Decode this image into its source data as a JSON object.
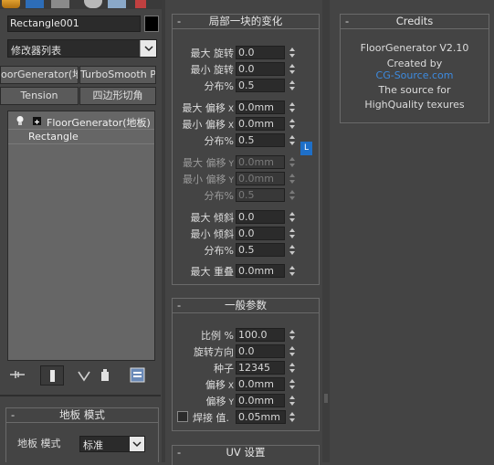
{
  "object": {
    "name": "Rectangle001",
    "color": "#000000"
  },
  "modifier_list": {
    "label": "修改器列表"
  },
  "modifier_buttons": [
    {
      "label": "oorGenerator(地林"
    },
    {
      "label": "TurboSmooth Pro"
    },
    {
      "label": "Tension"
    },
    {
      "label": "四边形切角"
    }
  ],
  "stack": {
    "items": [
      {
        "label": "FloorGenerator(地板)"
      },
      {
        "label": "Rectangle"
      }
    ]
  },
  "floor_mode": {
    "title": "地板 模式",
    "mode_label": "地板 模式",
    "mode_value": "标准"
  },
  "local_changes": {
    "title": "局部一块的变化",
    "fields": [
      {
        "label": "最大 旋转",
        "sub": "",
        "value": "0.0",
        "disabled": false
      },
      {
        "label": "最小 旋转",
        "sub": "",
        "value": "0.0",
        "disabled": false
      },
      {
        "label": "分布%",
        "sub": "",
        "value": "0.5",
        "disabled": false
      },
      {
        "label": "最大 偏移",
        "sub": "X",
        "value": "0.0mm",
        "disabled": false
      },
      {
        "label": "最小 偏移",
        "sub": "X",
        "value": "0.0mm",
        "disabled": false
      },
      {
        "label": "分布%",
        "sub": "",
        "value": "0.5",
        "disabled": false
      },
      {
        "label": "最大 偏移",
        "sub": "Y",
        "value": "0.0mm",
        "disabled": true
      },
      {
        "label": "最小 偏移",
        "sub": "Y",
        "value": "0.0mm",
        "disabled": true
      },
      {
        "label": "分布%",
        "sub": "",
        "value": "0.5",
        "disabled": true
      },
      {
        "label": "最大 倾斜",
        "sub": "",
        "value": "0.0",
        "disabled": false
      },
      {
        "label": "最小 倾斜",
        "sub": "",
        "value": "0.0",
        "disabled": false
      },
      {
        "label": "分布%",
        "sub": "",
        "value": "0.5",
        "disabled": false
      },
      {
        "label": "最大 重叠",
        "sub": "",
        "value": "0.0mm",
        "disabled": false
      }
    ],
    "lock_button": "L"
  },
  "general_params": {
    "title": "一般参数",
    "fields": [
      {
        "label": "比例 %",
        "sub": "",
        "value": "100.0"
      },
      {
        "label": "旋转方向",
        "sub": "",
        "value": "0.0"
      },
      {
        "label": "种子",
        "sub": "",
        "value": "12345"
      },
      {
        "label": "偏移",
        "sub": "X",
        "value": "0.0mm"
      },
      {
        "label": "偏移",
        "sub": "Y",
        "value": "0.0mm"
      }
    ],
    "weld_label": "焊接 值.",
    "weld_value": "0.05mm",
    "weld_checked": false
  },
  "uv_settings": {
    "title": "UV 设置"
  },
  "credits": {
    "title": "Credits",
    "line1": "FloorGenerator V2.10",
    "line2": "Created by",
    "link": "CG-Source.com",
    "line3": "The source for",
    "line4": "HighQuality texures"
  },
  "colors": {
    "accent_blue": "#1e6fc8",
    "link_blue": "#3d8be0",
    "panel": "#444444",
    "field": "#2b2b2b"
  },
  "icons": [
    "create-icon",
    "modify-icon",
    "hierarchy-icon",
    "motion-icon",
    "display-icon",
    "utilities-icon",
    "pin-stack-icon",
    "show-end-result-icon",
    "make-unique-icon",
    "remove-modifier-icon",
    "configure-modifier-sets-icon",
    "light-bulb-icon"
  ]
}
